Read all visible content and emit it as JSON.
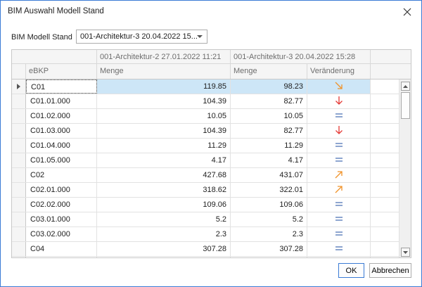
{
  "window": {
    "title": "BIM Auswahl Modell Stand"
  },
  "selector": {
    "label": "BIM Modell Stand",
    "value": "001-Architektur-3 20.04.2022 15..."
  },
  "grid": {
    "bands": [
      "001-Architektur-2 27.01.2022 11:21",
      "001-Architektur-3 20.04.2022 15:28"
    ],
    "columns": {
      "ebkp": "eBKP",
      "menge1": "Menge",
      "menge2": "Menge",
      "change": "Veränderung"
    },
    "rows": [
      {
        "ebkp": "C01",
        "menge1": "119.85",
        "menge2": "98.23",
        "change": "decrease-slight",
        "selected": true
      },
      {
        "ebkp": "C01.01.000",
        "menge1": "104.39",
        "menge2": "82.77",
        "change": "decrease"
      },
      {
        "ebkp": "C01.02.000",
        "menge1": "10.05",
        "menge2": "10.05",
        "change": "equal"
      },
      {
        "ebkp": "C01.03.000",
        "menge1": "104.39",
        "menge2": "82.77",
        "change": "decrease"
      },
      {
        "ebkp": "C01.04.000",
        "menge1": "11.29",
        "menge2": "11.29",
        "change": "equal"
      },
      {
        "ebkp": "C01.05.000",
        "menge1": "4.17",
        "menge2": "4.17",
        "change": "equal"
      },
      {
        "ebkp": "C02",
        "menge1": "427.68",
        "menge2": "431.07",
        "change": "increase-slight"
      },
      {
        "ebkp": "C02.01.000",
        "menge1": "318.62",
        "menge2": "322.01",
        "change": "increase-slight"
      },
      {
        "ebkp": "C02.02.000",
        "menge1": "109.06",
        "menge2": "109.06",
        "change": "equal"
      },
      {
        "ebkp": "C03.01.000",
        "menge1": "5.2",
        "menge2": "5.2",
        "change": "equal"
      },
      {
        "ebkp": "C03.02.000",
        "menge1": "2.3",
        "menge2": "2.3",
        "change": "equal"
      },
      {
        "ebkp": "C04",
        "menge1": "307.28",
        "menge2": "307.28",
        "change": "equal"
      },
      {
        "ebkp": "",
        "menge1": "",
        "menge2": "",
        "change": ""
      }
    ]
  },
  "buttons": {
    "ok": "OK",
    "cancel": "Abbrechen"
  },
  "colors": {
    "accent": "#3a7bd5",
    "selection": "#cde6f7",
    "decrease": "#e53935",
    "increase": "#f0932b",
    "equal": "#4a72b5"
  }
}
